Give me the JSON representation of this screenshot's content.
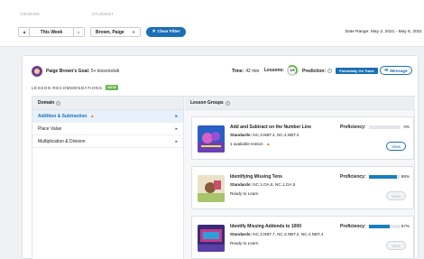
{
  "filters": {
    "viewing_label": "VIEWING",
    "student_label": "STUDENT",
    "week_value": "This Week",
    "student_value": "Brown, Paige",
    "clear_filter": "Clear Filter",
    "date_range": "Date Range: May 2, 2021 - May 6, 2021"
  },
  "goal": {
    "name_text": "Paige Brown's Goal:",
    "goal_value": "5+ lessons/wk",
    "time_label": "Time:",
    "time_value": "42 min",
    "lessons_label": "Lessons:",
    "lessons_value": "2/5",
    "prediction_label": "Prediction:",
    "prediction_badge": "Potentially On Track",
    "message_button": "Message"
  },
  "recommendations": {
    "title": "LESSON RECOMMENDATIONS",
    "new_badge": "NEW"
  },
  "domain": {
    "header": "Domain",
    "items": [
      {
        "label": "Addition & Subtraction"
      },
      {
        "label": "Place Value"
      },
      {
        "label": "Multiplication & Division"
      }
    ]
  },
  "lesson_groups": {
    "header": "Lesson Groups",
    "items": [
      {
        "title": "Add and Subtract on the Number Line",
        "standards_label": "Standards:",
        "standards": "NC.3.NBT.2, NC.4.NBT.4",
        "status": "1 available lesson",
        "proficiency_label": "Proficiency:",
        "proficiency": 0,
        "proficiency_text": "0%",
        "view": "View"
      },
      {
        "title": "Identifying Missing Tens",
        "standards_label": "Standards:",
        "standards": "NC.1.OA.8, NC.1.OA.5",
        "status": "Ready to Learn",
        "proficiency_label": "Proficiency:",
        "proficiency": 88,
        "proficiency_text": "88%",
        "view": "View"
      },
      {
        "title": "Identify Missing Addends to 1000",
        "standards_label": "Standards:",
        "standards": "NC.2.NBT.7, NC.3.NBT.2, NC.4.NBT.4",
        "status": "Ready to Learn",
        "proficiency_label": "Proficiency:",
        "proficiency": 67,
        "proficiency_text": "67%",
        "view": "View"
      }
    ]
  },
  "colors": {
    "accent": "#1a6fb5",
    "bar_fill": "#1a7fc0",
    "new_badge": "#6bb64a",
    "warning": "#e87e1c"
  }
}
